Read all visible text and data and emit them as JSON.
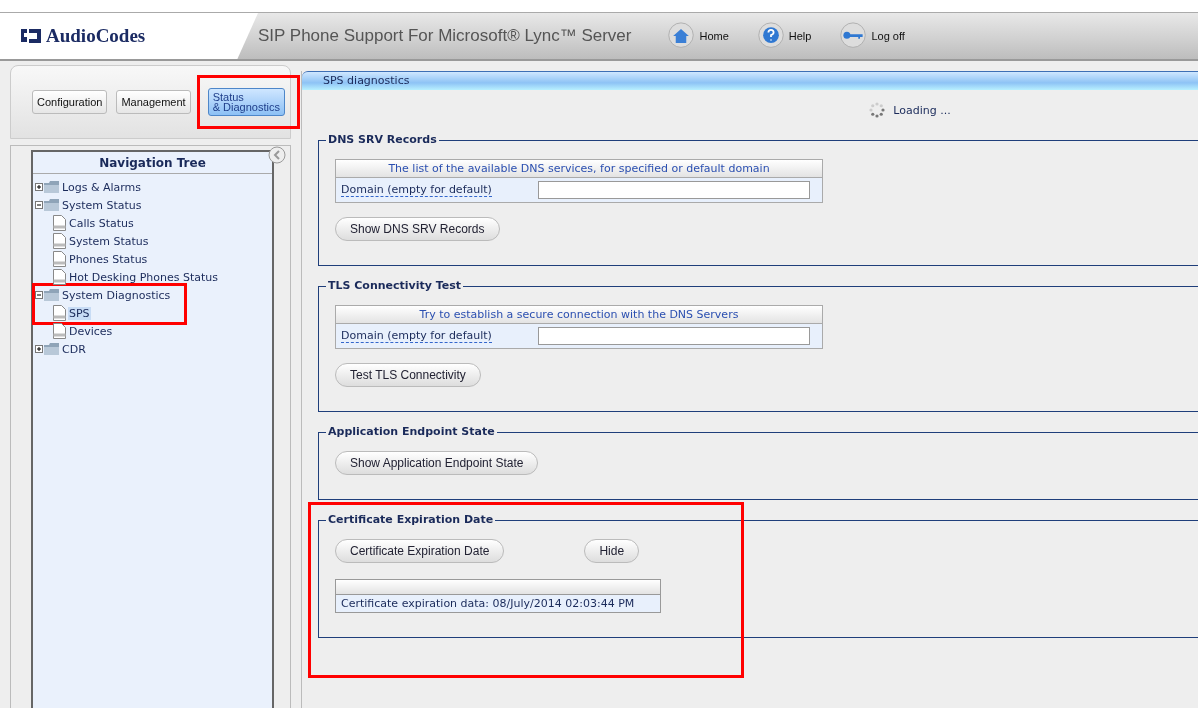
{
  "header": {
    "logo": "AudioCodes",
    "title": "SIP Phone Support For Microsoft® Lync™ Server",
    "nav": [
      {
        "kind": "home",
        "label": "Home"
      },
      {
        "kind": "help",
        "label": "Help"
      },
      {
        "kind": "logoff",
        "label": "Log off"
      }
    ]
  },
  "tabs": [
    {
      "label": "Configuration",
      "selected": false,
      "highlighted": false
    },
    {
      "label": "Management",
      "selected": false,
      "highlighted": false
    },
    {
      "label": "Status\n& Diagnostics",
      "selected": true,
      "highlighted": true
    }
  ],
  "tree": {
    "title": "Navigation Tree",
    "items": [
      {
        "label": "Logs & Alarms",
        "kind": "folder",
        "expanded": false,
        "selected": false,
        "highlighted": false
      },
      {
        "label": "System Status",
        "kind": "folder",
        "expanded": true,
        "selected": false,
        "highlighted": false,
        "children": [
          {
            "label": "Calls Status",
            "kind": "page",
            "selected": false,
            "highlighted": false
          },
          {
            "label": "System Status",
            "kind": "page",
            "selected": false,
            "highlighted": false
          },
          {
            "label": "Phones Status",
            "kind": "page",
            "selected": false,
            "highlighted": false
          },
          {
            "label": "Hot Desking Phones Status",
            "kind": "page",
            "selected": false,
            "highlighted": false
          }
        ]
      },
      {
        "label": "System Diagnostics",
        "kind": "folder",
        "expanded": true,
        "selected": false,
        "highlighted": true,
        "children": [
          {
            "label": "SPS",
            "kind": "page",
            "selected": true,
            "highlighted": true
          },
          {
            "label": "Devices",
            "kind": "page",
            "selected": false,
            "highlighted": false
          }
        ]
      },
      {
        "label": "CDR",
        "kind": "folder",
        "expanded": false,
        "selected": false,
        "highlighted": false
      }
    ]
  },
  "content": {
    "title": "SPS diagnostics",
    "status": "Loading ...",
    "sections": [
      {
        "legend": "DNS SRV Records",
        "highlighted": false,
        "form": {
          "caption": "The list of the available DNS services, for specified or default domain",
          "label": "Domain (empty for default)"
        },
        "buttons": [
          "Show DNS SRV Records"
        ]
      },
      {
        "legend": "TLS Connectivity Test",
        "highlighted": false,
        "form": {
          "caption": "Try to establish a secure connection with the DNS Servers",
          "label": "Domain (empty for default)"
        },
        "buttons": [
          "Test TLS Connectivity"
        ]
      },
      {
        "legend": "Application Endpoint State",
        "highlighted": false,
        "buttons": [
          "Show Application Endpoint State"
        ]
      },
      {
        "legend": "Certificate Expiration Date",
        "highlighted": true,
        "buttons": [
          "Certificate Expiration Date",
          "Hide"
        ],
        "result": "Certificate expiration data: 08/July/2014 02:03:44 PM"
      }
    ]
  }
}
